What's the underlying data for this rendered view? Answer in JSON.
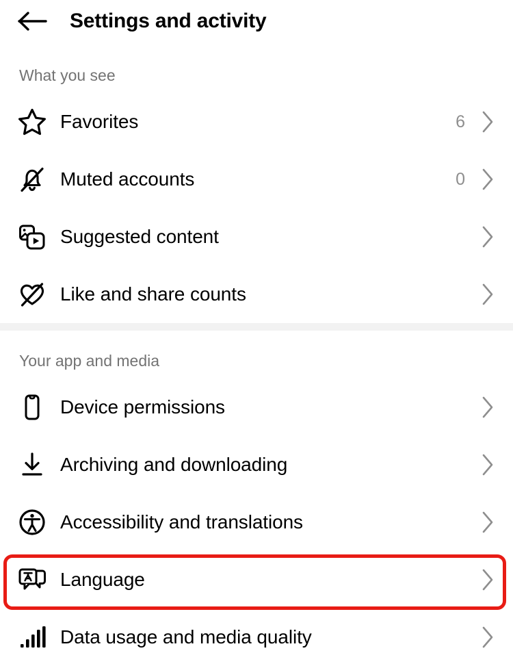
{
  "header": {
    "back_icon": "arrow-left-icon",
    "title": "Settings and activity"
  },
  "sections": [
    {
      "heading": "What you see",
      "items": [
        {
          "icon": "star-icon",
          "label": "Favorites",
          "count": "6",
          "chevron": "chevron-right-icon"
        },
        {
          "icon": "bell-muted-icon",
          "label": "Muted accounts",
          "count": "0",
          "chevron": "chevron-right-icon"
        },
        {
          "icon": "suggested-media-icon",
          "label": "Suggested content",
          "count": "",
          "chevron": "chevron-right-icon"
        },
        {
          "icon": "heart-slash-icon",
          "label": "Like and share counts",
          "count": "",
          "chevron": "chevron-right-icon"
        }
      ]
    },
    {
      "heading": "Your app and media",
      "items": [
        {
          "icon": "phone-icon",
          "label": "Device permissions",
          "count": "",
          "chevron": "chevron-right-icon"
        },
        {
          "icon": "download-icon",
          "label": "Archiving and downloading",
          "count": "",
          "chevron": "chevron-right-icon"
        },
        {
          "icon": "accessibility-icon",
          "label": "Accessibility and translations",
          "count": "",
          "chevron": "chevron-right-icon"
        },
        {
          "icon": "language-icon",
          "label": "Language",
          "count": "",
          "chevron": "chevron-right-icon"
        },
        {
          "icon": "signal-bars-icon",
          "label": "Data usage and media quality",
          "count": "",
          "chevron": "chevron-right-icon"
        }
      ]
    }
  ],
  "highlight": {
    "target_label": "Language",
    "color": "#e81c15"
  },
  "colors": {
    "background": "#ffffff",
    "text": "#000000",
    "muted_text": "#737373",
    "count_text": "#8e8e8e",
    "chevron": "#8e8e8e",
    "divider": "#f2f2f2",
    "highlight": "#e81c15"
  }
}
